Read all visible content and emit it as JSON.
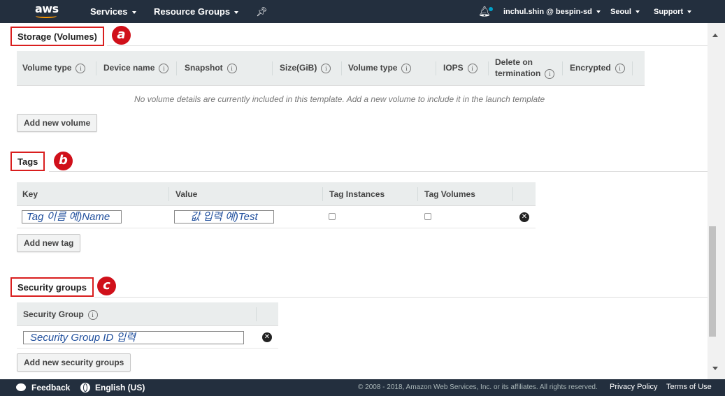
{
  "nav": {
    "logo": "aws",
    "services": "Services",
    "resource_groups": "Resource Groups",
    "user": "inchul.shin @ bespin-sd",
    "region": "Seoul",
    "support": "Support"
  },
  "storage": {
    "title": "Storage (Volumes)",
    "marker": "a",
    "columns": [
      "Volume type",
      "Device name",
      "Snapshot",
      "Size(GiB)",
      "Volume type",
      "IOPS",
      "Delete on",
      "termination",
      "Encrypted"
    ],
    "empty_message": "No volume details are currently included in this template. Add a new volume to include it in the launch template",
    "add_button": "Add new volume"
  },
  "tags": {
    "title": "Tags",
    "marker": "b",
    "columns": [
      "Key",
      "Value",
      "Tag Instances",
      "Tag Volumes"
    ],
    "key_value": "Tag 이름 예)Name",
    "value_value": "값 입력 예)Test",
    "tag_instances_checked": false,
    "tag_volumes_checked": false,
    "add_button": "Add new tag"
  },
  "security_groups": {
    "title": "Security groups",
    "marker": "c",
    "column": "Security Group",
    "input_value": "Security Group ID 입력",
    "add_button": "Add new security groups"
  },
  "footer": {
    "feedback": "Feedback",
    "language": "English (US)",
    "copyright": "© 2008 - 2018, Amazon Web Services, Inc. or its affiliates. All rights reserved.",
    "privacy": "Privacy Policy",
    "terms": "Terms of Use"
  },
  "colors": {
    "nav_bg": "#232f3e",
    "annotation_red": "#d0101a",
    "table_header_bg": "#eaeded"
  }
}
